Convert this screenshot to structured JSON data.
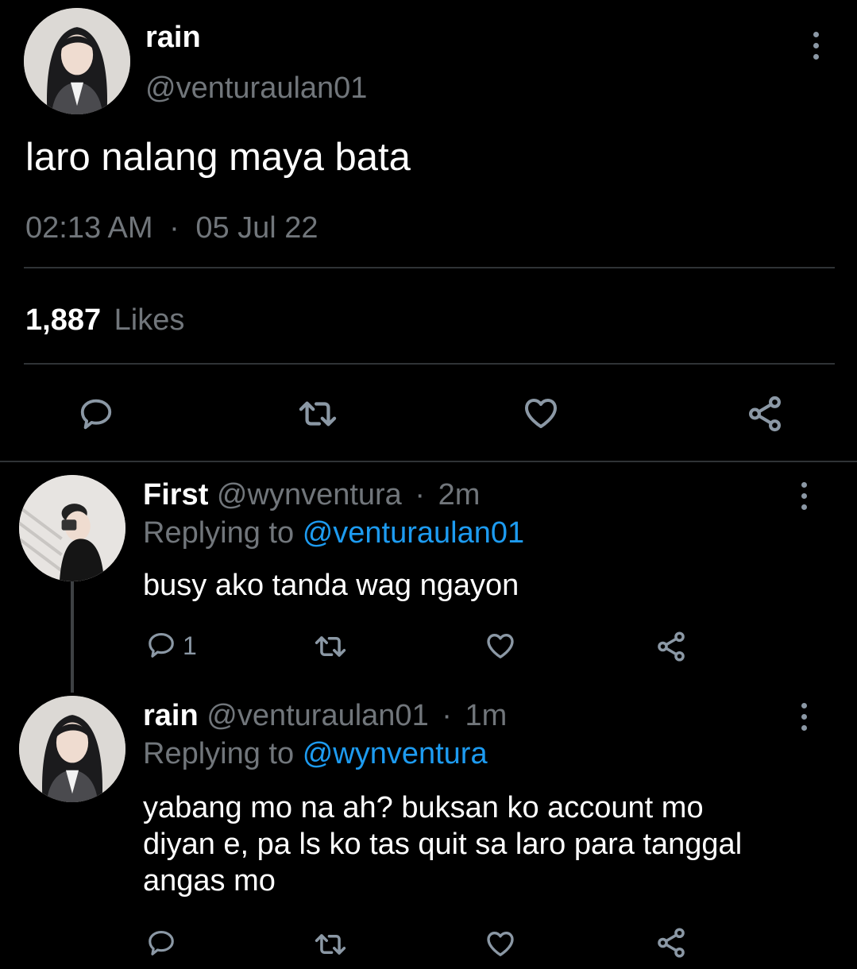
{
  "main_tweet": {
    "name": "rain",
    "handle": "@venturaulan01",
    "text": "laro nalang maya bata",
    "time": "02:13 AM",
    "separator": "·",
    "date": "05 Jul 22",
    "likes_count": "1,887",
    "likes_label": "Likes"
  },
  "replies": [
    {
      "name": "First",
      "handle": "@wynventura",
      "separator": "·",
      "age": "2m",
      "replying_prefix": "Replying to",
      "replying_to": "@venturaulan01",
      "text": "busy ako tanda wag ngayon",
      "reply_count": "1"
    },
    {
      "name": "rain",
      "handle": "@venturaulan01",
      "separator": "·",
      "age": "1m",
      "replying_prefix": "Replying to",
      "replying_to": "@wynventura",
      "text_lines": [
        "yabang mo na ah? buksan ko account mo",
        "diyan e, pa ls ko tas quit sa laro para tanggal",
        "angas mo"
      ]
    }
  ],
  "icons": {
    "reply": "reply-icon",
    "retweet": "retweet-icon",
    "like": "heart-icon",
    "share": "share-icon",
    "more": "more-vertical-icon"
  },
  "colors": {
    "background": "#000000",
    "text": "#e7e9ea",
    "muted": "#71767b",
    "link": "#1d9bf0",
    "icon": "#8b98a5",
    "divider": "#2f3336"
  }
}
